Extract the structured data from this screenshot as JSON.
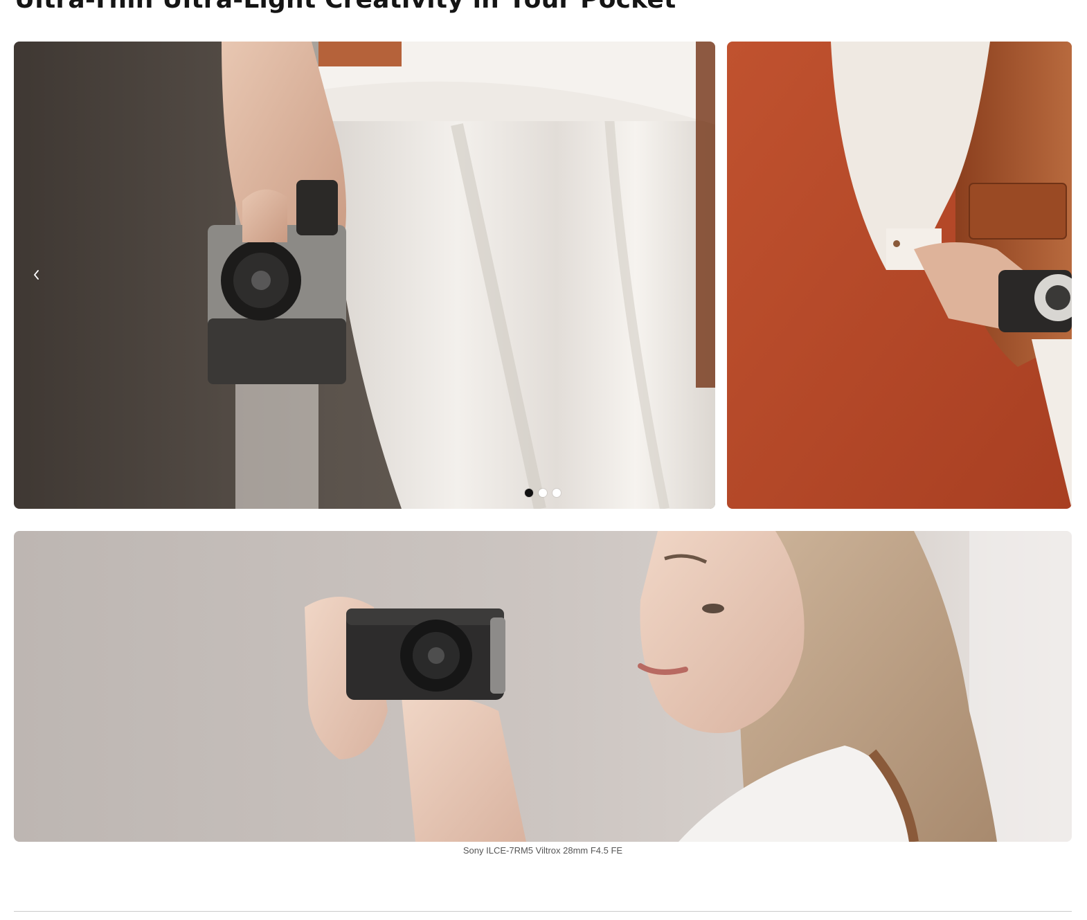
{
  "section": {
    "heading": "Ultra-Thin Ultra-Light Creativity in Your Pocket"
  },
  "carousel": {
    "prev_icon": "chevron-left-icon",
    "slides": [
      {
        "subject": "hand holding silver camera",
        "background": "#4a433d"
      },
      {
        "subject": "hand holding camera at hip",
        "background": "#b84a2a"
      }
    ],
    "dots": [
      {
        "active": true
      },
      {
        "active": false
      },
      {
        "active": false
      }
    ]
  },
  "feature_photo": {
    "caption": "Sony ILCE-7RM5 Viltrox 28mm F4.5 FE"
  },
  "colors": {
    "heading": "#151515",
    "caption": "#555555",
    "dot_active": "#111111",
    "dot_inactive": "#ffffff",
    "divider": "#c9c9c9"
  }
}
